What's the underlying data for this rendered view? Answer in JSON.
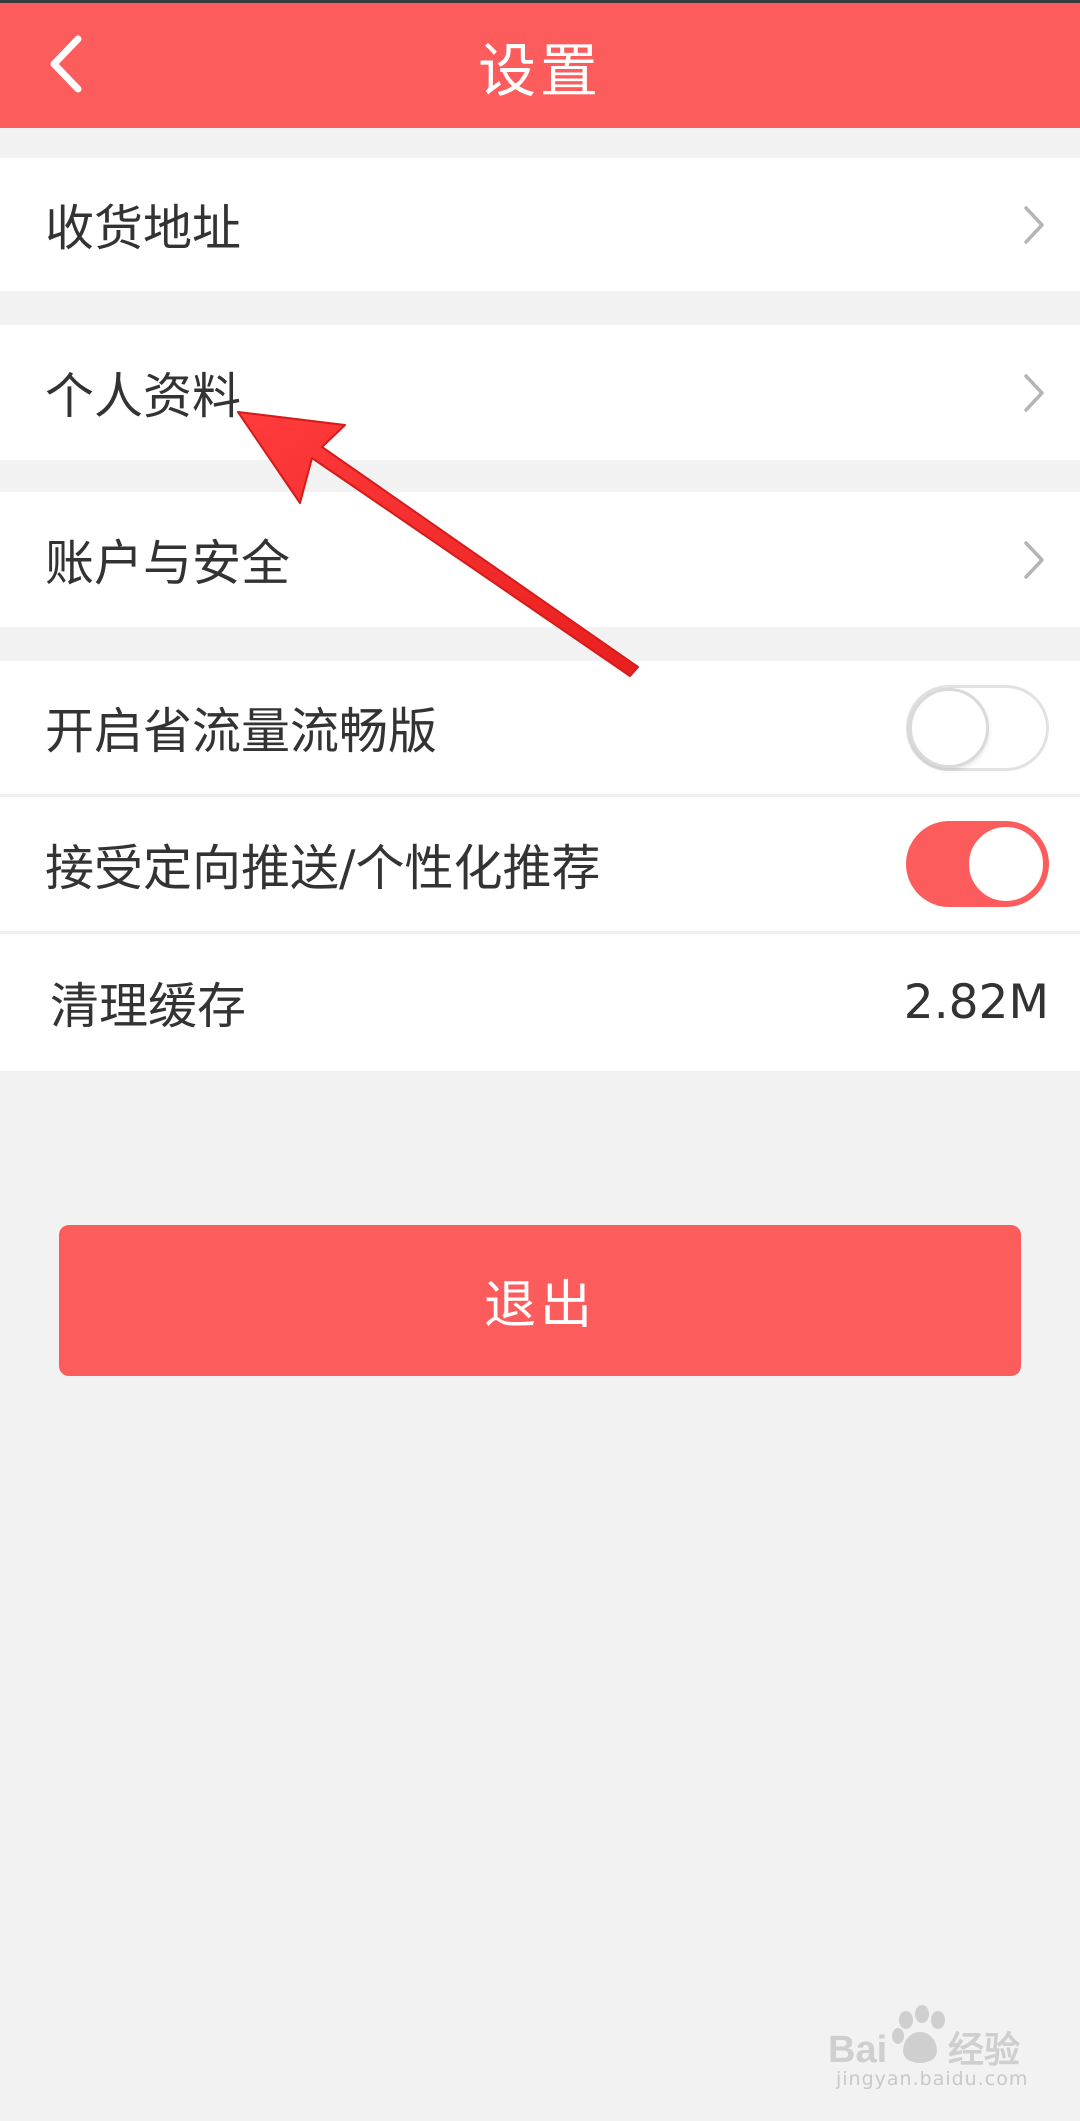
{
  "header": {
    "title": "设置",
    "back_icon": "chevron-left-icon"
  },
  "settings": {
    "address_label": "收货地址",
    "profile_label": "个人资料",
    "account_label": "账户与安全",
    "data_saver_label": "开启省流量流畅版",
    "data_saver_on": false,
    "push_label": "接受定向推送/个性化推荐",
    "push_on": true,
    "cache_label": "清理缓存",
    "cache_value": "2.82M"
  },
  "logout_label": "退出",
  "watermark": {
    "brand": "Baidu经验",
    "url": "jingyan.baidu.com"
  },
  "colors": {
    "accent": "#fd5c5c",
    "background": "#f2f2f2",
    "text": "#333333",
    "annotation_arrow": "#ff2d2d"
  }
}
